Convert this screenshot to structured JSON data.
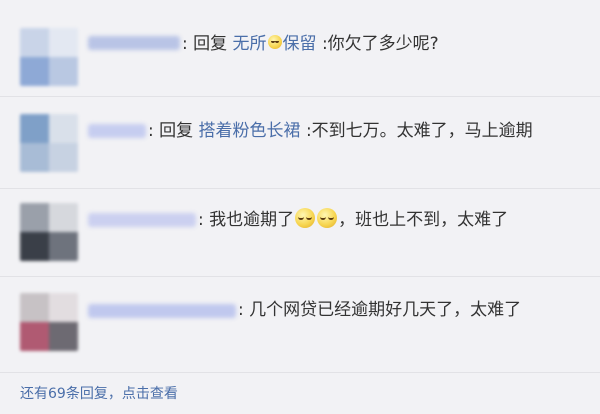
{
  "comments": [
    {
      "reply_word": "回复",
      "target_part1": "无所",
      "target_emoji": "emoji-icon",
      "target_part2": "保留",
      "text": ":你欠了多少呢?"
    },
    {
      "reply_word": "回复",
      "target": "搭着粉色长裙",
      "text": ":不到七万。太难了，马上逾期"
    },
    {
      "text_part1": "我也逾期了",
      "text_part2": "，班也上不到，太难了"
    },
    {
      "text": "几个网贷已经逾期好几天了，太难了"
    }
  ],
  "footer": {
    "more_replies": "还有69条回复，",
    "view_link": "点击查看"
  }
}
